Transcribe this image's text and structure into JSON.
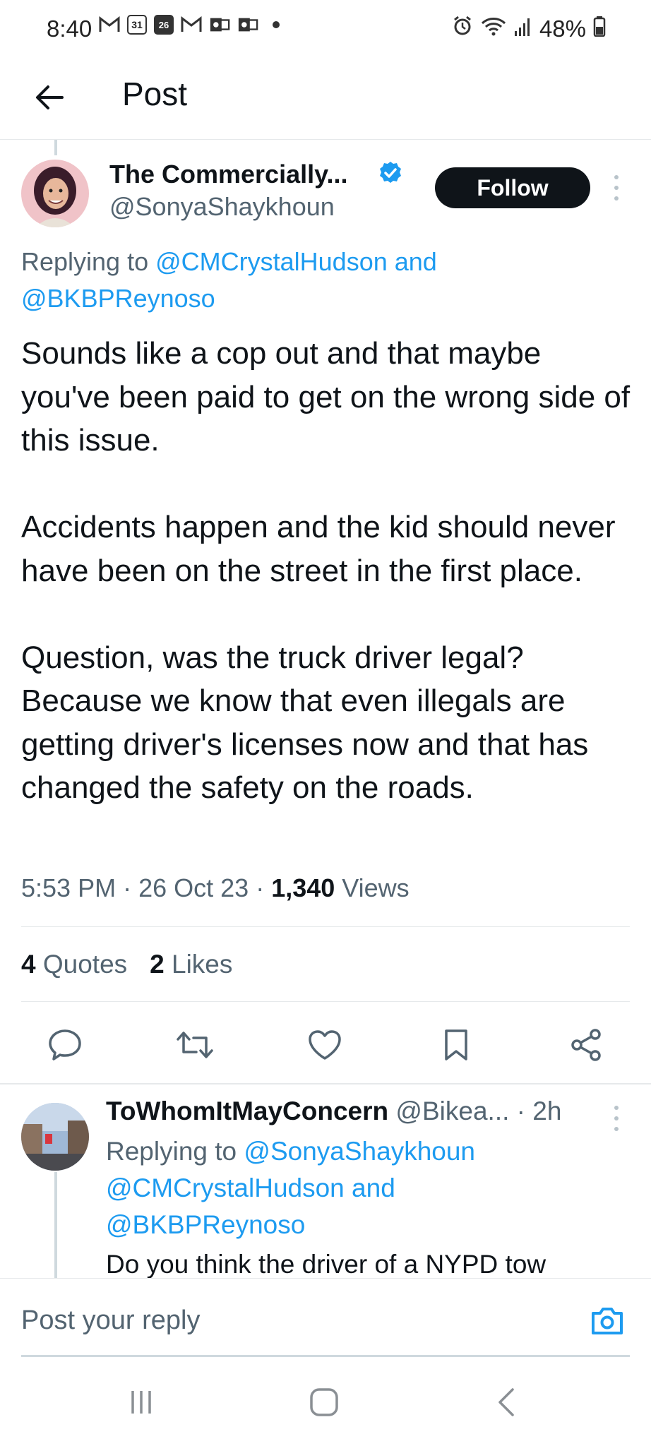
{
  "status_bar": {
    "time": "8:40",
    "notification_icons": [
      "gmail-icon",
      "calendar-31-icon",
      "calendar-26-icon",
      "gmail-icon",
      "outlook-icon",
      "outlook-icon",
      "dot-icon"
    ],
    "calendar_day_a": "31",
    "calendar_day_b": "26",
    "battery": "48%"
  },
  "header": {
    "title": "Post"
  },
  "tweet": {
    "author_name": "The Commercially...",
    "author_handle": "@SonyaShaykhoun",
    "follow_label": "Follow",
    "replying_prefix": "Replying to ",
    "replying_to_1": "@CMCrystalHudson",
    "replying_and": " and ",
    "replying_to_2": "@BKBPReynoso",
    "paragraphs": [
      "Sounds like a cop out and that maybe you've been paid to get on the wrong side of this issue.",
      "Accidents happen and the kid should never have been on the street in the first place.",
      "Question, was the truck driver legal? Because we know that even illegals are getting driver's licenses now and that has changed the safety on the roads."
    ],
    "time": "5:53 PM",
    "date": "26 Oct 23",
    "views_count": "1,340",
    "views_label": " Views",
    "quotes_count": "4",
    "quotes_label": " Quotes",
    "likes_count": "2",
    "likes_label": " Likes",
    "accent_color": "#1d9bf0"
  },
  "reply": {
    "author_name": "ToWhomItMayConcern",
    "author_handle": "@Bikea...",
    "age": "2h",
    "replying_prefix": "Replying to ",
    "replying_to_1": "@SonyaShaykhoun",
    "replying_to_2": "@CMCrystalHudson",
    "replying_and": " and",
    "replying_to_3": "@BKBPReynoso",
    "text": "Do you think the driver of a NYPD tow"
  },
  "compose": {
    "placeholder": "Post your reply"
  }
}
